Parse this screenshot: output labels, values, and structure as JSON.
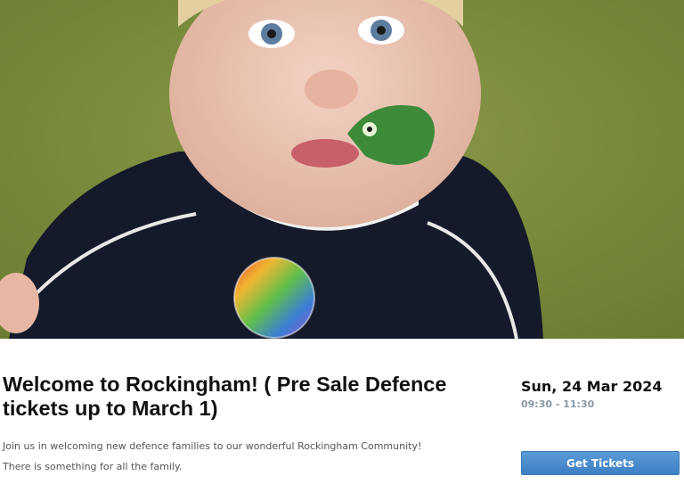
{
  "event": {
    "image_alt": "Event photo",
    "title": "Welcome to Rockingham! ( Pre Sale Defence tickets up to March 1)",
    "description": [
      "Join us in welcoming new defence families to our wonderful Rockingham Community!",
      "There is something for all the family.",
      ""
    ],
    "date": "Sun, 24 Mar 2024",
    "time": "09:30 - 11:30",
    "get_tickets_label": "Get Tickets"
  },
  "colors": {
    "button": "#4a8cce",
    "time_text": "#8a9aa8"
  }
}
